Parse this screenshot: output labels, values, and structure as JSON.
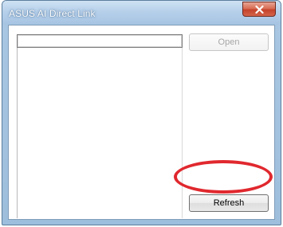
{
  "window": {
    "title": "ASUS AI Direct Link"
  },
  "titlebar": {
    "close_icon": "close-x-icon"
  },
  "toolbar": {
    "path_value": "",
    "open_label": "Open",
    "refresh_label": "Refresh"
  },
  "colors": {
    "titlebar": "#b6d0ea",
    "close_button": "#c4432a",
    "highlight_ring": "#e0282e"
  }
}
